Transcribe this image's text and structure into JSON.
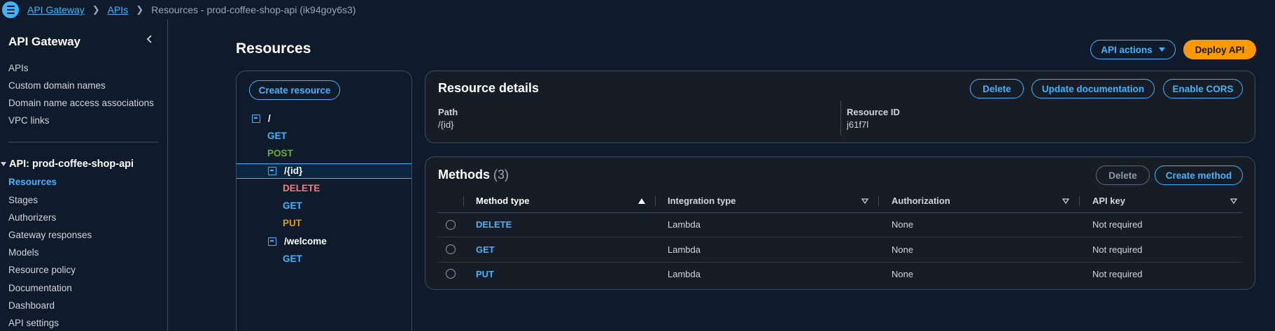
{
  "breadcrumb": {
    "items": [
      {
        "label": "API Gateway",
        "link": true
      },
      {
        "label": "APIs",
        "link": true
      },
      {
        "label": "Resources - prod-coffee-shop-api (ik94goy6s3)",
        "link": false
      }
    ]
  },
  "sidebar": {
    "title": "API Gateway",
    "top_items": [
      "APIs",
      "Custom domain names",
      "Domain name access associations",
      "VPC links"
    ],
    "api_section_label": "API: prod-coffee-shop-api",
    "api_items": [
      "Resources",
      "Stages",
      "Authorizers",
      "Gateway responses",
      "Models",
      "Resource policy",
      "Documentation",
      "Dashboard",
      "API settings"
    ],
    "active_item": "Resources"
  },
  "header": {
    "title": "Resources",
    "api_actions_label": "API actions",
    "deploy_label": "Deploy API"
  },
  "tree": {
    "create_resource_label": "Create resource",
    "nodes": [
      {
        "label": "/",
        "type": "resource"
      },
      {
        "label": "GET",
        "type": "method",
        "color": "#42b4ff"
      },
      {
        "label": "POST",
        "type": "method",
        "color": "#6aaf35"
      },
      {
        "label": "/{id}",
        "type": "resource",
        "selected": true
      },
      {
        "label": "DELETE",
        "type": "method",
        "color": "#ff7a7a"
      },
      {
        "label": "GET",
        "type": "method",
        "color": "#42b4ff"
      },
      {
        "label": "PUT",
        "type": "method",
        "color": "#e0a200"
      },
      {
        "label": "/welcome",
        "type": "resource"
      },
      {
        "label": "GET",
        "type": "method",
        "color": "#42b4ff"
      }
    ]
  },
  "resource_details": {
    "title": "Resource details",
    "delete_label": "Delete",
    "update_doc_label": "Update documentation",
    "enable_cors_label": "Enable CORS",
    "path_label": "Path",
    "path_value": "/{id}",
    "resource_id_label": "Resource ID",
    "resource_id_value": "j61f7l"
  },
  "methods": {
    "title": "Methods",
    "count": "(3)",
    "delete_label": "Delete",
    "create_label": "Create method",
    "columns": [
      "Method type",
      "Integration type",
      "Authorization",
      "API key"
    ],
    "rows": [
      {
        "method": "DELETE",
        "integration": "Lambda",
        "authorization": "None",
        "api_key": "Not required"
      },
      {
        "method": "GET",
        "integration": "Lambda",
        "authorization": "None",
        "api_key": "Not required"
      },
      {
        "method": "PUT",
        "integration": "Lambda",
        "authorization": "None",
        "api_key": "Not required"
      }
    ]
  },
  "colors": {
    "link": "#42b4ff",
    "primary_button": "#ff9900",
    "background": "#0f1b2a",
    "container": "#161d26"
  }
}
